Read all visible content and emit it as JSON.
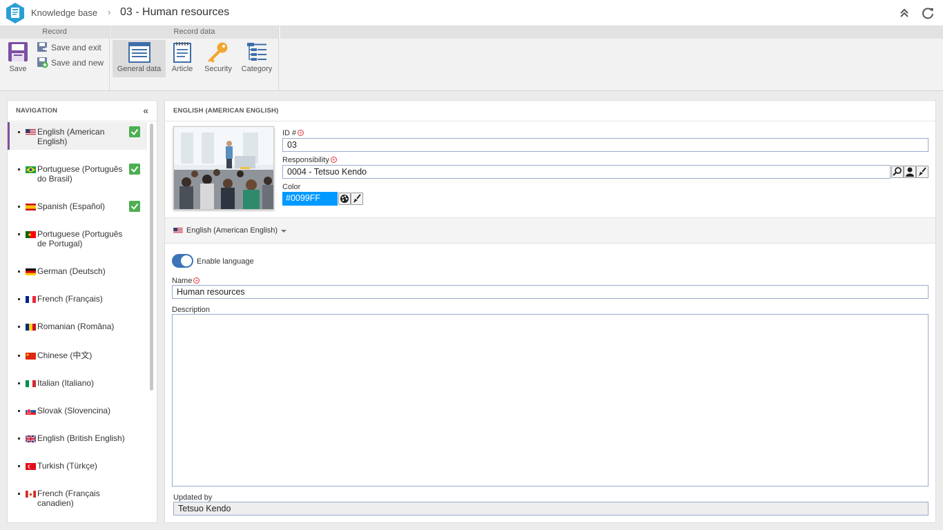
{
  "header": {
    "breadcrumb_root": "Knowledge base",
    "separator": "›",
    "title": "03 - Human resources"
  },
  "ribbon": {
    "record_group": "Record",
    "record_data_group": "Record data",
    "save": "Save",
    "save_and_exit": "Save and exit",
    "save_and_new": "Save and new",
    "general_data": "General data",
    "article": "Article",
    "security": "Security",
    "category": "Category"
  },
  "nav": {
    "title": "NAVIGATION",
    "items": [
      {
        "label": "English (American English)",
        "flag": "us",
        "checked": true,
        "selected": true
      },
      {
        "label": "Portuguese (Português do Brasil)",
        "flag": "br",
        "checked": true
      },
      {
        "label": "Spanish (Español)",
        "flag": "es",
        "checked": true
      },
      {
        "label": "Portuguese (Português de Portugal)",
        "flag": "pt",
        "checked": false
      },
      {
        "label": "German (Deutsch)",
        "flag": "de",
        "checked": false
      },
      {
        "label": "French (Français)",
        "flag": "fr",
        "checked": false
      },
      {
        "label": "Romanian (Româna)",
        "flag": "ro",
        "checked": false
      },
      {
        "label": "Chinese (中文)",
        "flag": "cn",
        "checked": false
      },
      {
        "label": "Italian (Italiano)",
        "flag": "it",
        "checked": false
      },
      {
        "label": "Slovak (Slovencina)",
        "flag": "sk",
        "checked": false
      },
      {
        "label": "English (British English)",
        "flag": "gb",
        "checked": false
      },
      {
        "label": "Turkish (Türkçe)",
        "flag": "tr",
        "checked": false
      },
      {
        "label": "French (Français canadien)",
        "flag": "ca",
        "checked": false
      }
    ]
  },
  "main": {
    "section_title": "ENGLISH (AMERICAN ENGLISH)",
    "id_label": "ID #",
    "id_value": "03",
    "responsibility_label": "Responsibility",
    "responsibility_value": "0004 - Tetsuo Kendo",
    "color_label": "Color",
    "color_value": "#0099FF",
    "language_selector": "English (American English)",
    "enable_language": "Enable language",
    "name_label": "Name",
    "name_value": "Human resources",
    "description_label": "Description",
    "description_value": "",
    "updated_by_label": "Updated by",
    "updated_by_value": "Tetsuo Kendo"
  },
  "colors": {
    "accent": "#7f4f9d",
    "toggle_on": "#3b74b8",
    "check": "#4caf50",
    "swatch": "#0099FF"
  }
}
